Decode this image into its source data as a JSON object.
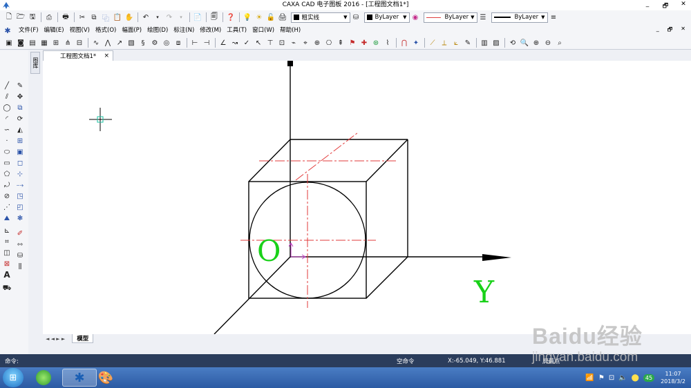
{
  "window": {
    "title": "CAXA CAD 电子图板 2016 - [工程图文档1*]",
    "controls": [
      "_",
      "🗗",
      "✕"
    ]
  },
  "toolbar_top": {
    "linetype_combo": "粗实线",
    "color_combo": "ByLayer",
    "line_combo": "ByLayer",
    "width_combo": "ByLayer"
  },
  "menu": {
    "items": [
      "文件(F)",
      "编辑(E)",
      "视图(V)",
      "格式(O)",
      "幅面(P)",
      "绘图(D)",
      "标注(N)",
      "修改(M)",
      "工具(T)",
      "窗口(W)",
      "帮助(H)"
    ],
    "mdi_controls": [
      "_",
      "🗗",
      "✕"
    ]
  },
  "side_tab": {
    "label": "图库"
  },
  "document_tab": {
    "label": "工程图文档1*",
    "close": "×"
  },
  "canvas": {
    "annotations": {
      "origin_label": "O",
      "y_label": "Y"
    }
  },
  "sheet_tabs": {
    "nav": "◄ ◄ ► ►",
    "active": "模型"
  },
  "status_bar": {
    "command_label": "命令:",
    "status_text": "空命令",
    "coordinates": "X:-65.049, Y:46.881",
    "snap_mode": "屏幕点"
  },
  "taskbar": {
    "time": "11:07",
    "date": "2018/3/2",
    "tray_badge": "45"
  },
  "watermark": {
    "brand": "Baidu经验",
    "url": "jingyan.baidu.com"
  },
  "colors": {
    "geometry": "#000000",
    "centerline": "#e23a3a",
    "label": "#19d119",
    "ucs": "#c03cc0",
    "status_bg": "#2b3d5c"
  }
}
